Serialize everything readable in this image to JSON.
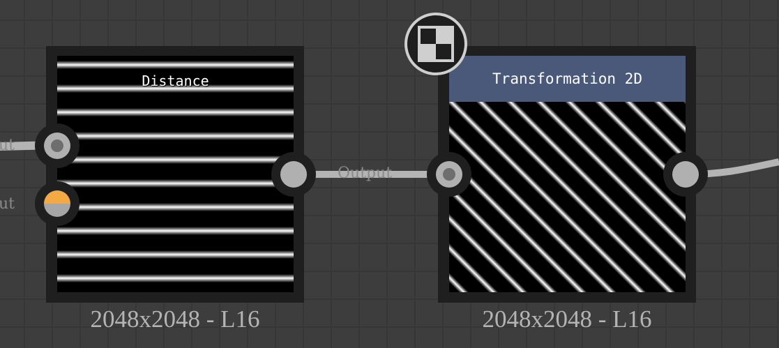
{
  "nodes": [
    {
      "title": "Distance",
      "resolution": "2048x2048 - L16",
      "inputs": [
        "ut",
        "ut"
      ]
    },
    {
      "title": "Transformation 2D",
      "resolution": "2048x2048 - L16",
      "title_bar_color": "#4a587a"
    }
  ],
  "connection": {
    "label": "Output"
  },
  "colors": {
    "background": "#3d3d3d",
    "grid": "#363636",
    "wire": "#b4b4b4",
    "port_accent": "#f4a942"
  },
  "badge_icon": "checker-icon"
}
